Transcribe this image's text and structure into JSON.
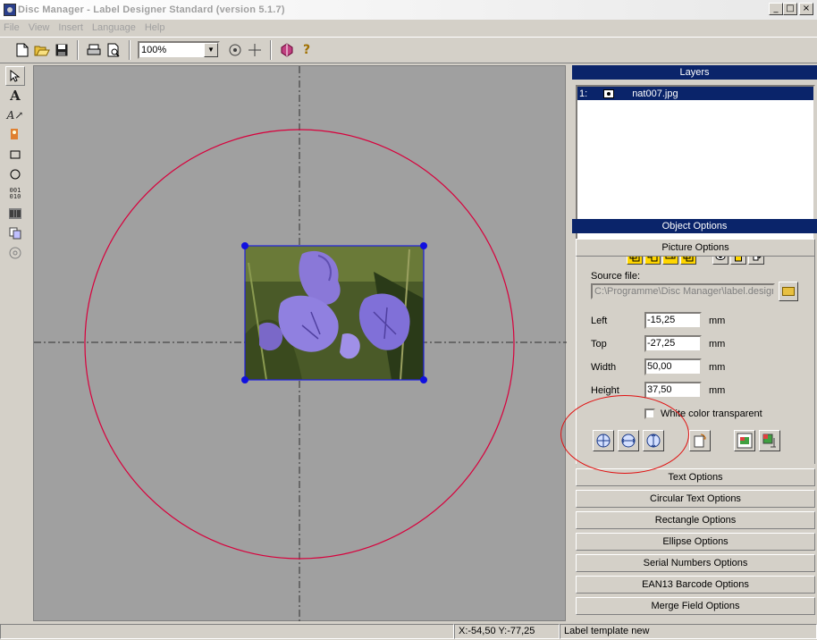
{
  "window": {
    "title": "Disc Manager - Label Designer Standard   (version 5.1.7)",
    "min": "_",
    "max": "□",
    "close": "×"
  },
  "menu": [
    "File",
    "View",
    "Insert",
    "Language",
    "Help"
  ],
  "toolbar": {
    "zoom": "100%",
    "icons": [
      "new-icon",
      "open-icon",
      "save-icon",
      "print-icon",
      "print-preview-icon",
      "center-icon",
      "crosshair-icon",
      "disc-icon",
      "help-icon"
    ]
  },
  "tools": [
    "pointer-tool",
    "text-tool",
    "circular-text-tool",
    "picture-tool",
    "rectangle-tool",
    "ellipse-tool",
    "serial-number-tool",
    "barcode-tool",
    "merge-field-tool",
    "disc-tool"
  ],
  "layers": {
    "header": "Layers",
    "items": [
      {
        "index": "1:",
        "name": "nat007.jpg"
      }
    ]
  },
  "object_options": {
    "header": "Object Options",
    "picture_options": "Picture Options",
    "source_label": "Source file:",
    "source_value": "C:\\Programme\\Disc Manager\\label.design",
    "left_label": "Left",
    "left_value": "-15,25",
    "top_label": "Top",
    "top_value": "-27,25",
    "width_label": "Width",
    "width_value": "50,00",
    "height_label": "Height",
    "height_value": "37,50",
    "unit": "mm",
    "transparent_label": "White color transparent",
    "sections": [
      "Text Options",
      "Circular Text Options",
      "Rectangle Options",
      "Ellipse Options",
      "Serial Numbers Options",
      "EAN13 Barcode Options",
      "Merge Field Options"
    ]
  },
  "status": {
    "coords": "X:-54,50  Y:-77,25",
    "message": "Label template new"
  },
  "colors": {
    "accent": "#0a246a",
    "guide_circle": "#d8003c",
    "handle": "#0000e0"
  }
}
